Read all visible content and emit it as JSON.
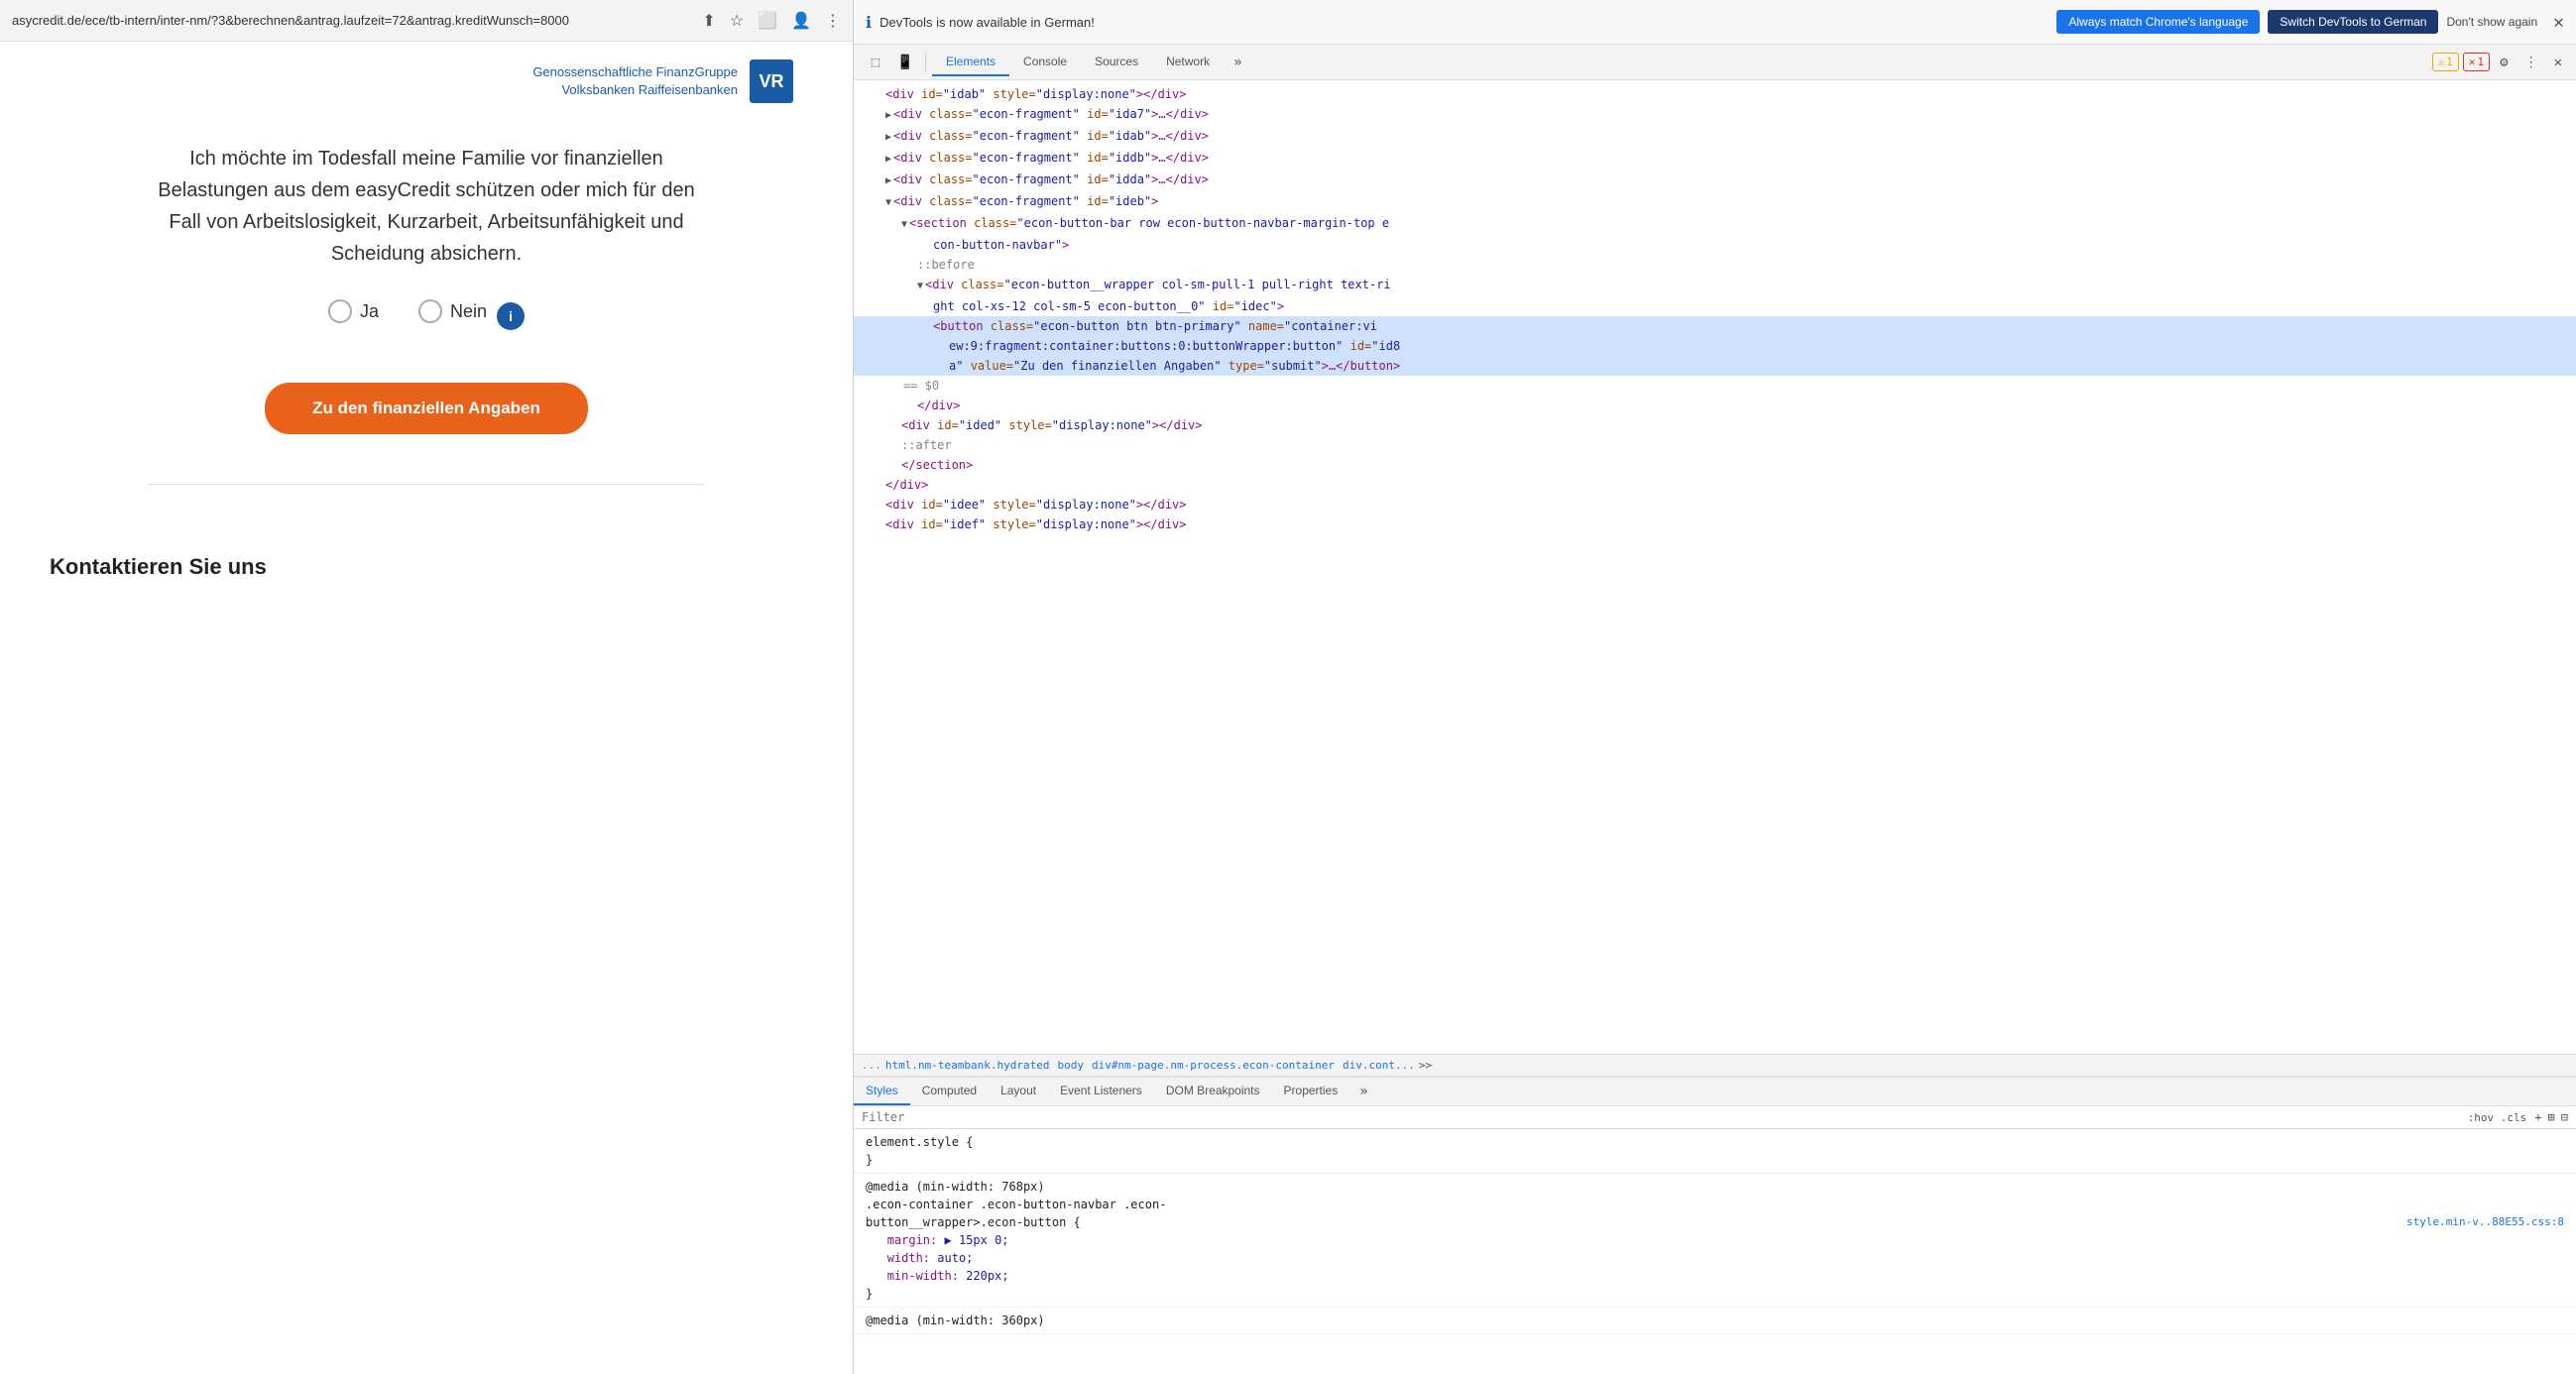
{
  "browser": {
    "url": "asycredit.de/ece/tb-intern/inter-nm/?3&berechnen&antrag.laufzeit=72&antrag.kreditWunsch=8000",
    "toolbar_icons": [
      "⬆",
      "★",
      "⬜",
      "👤",
      "⋮"
    ]
  },
  "webpage": {
    "logo_line1": "Genossenschaftliche FinanzGruppe",
    "logo_line2": "Volksbanken Raiffeisenbanken",
    "logo_letter": "VR",
    "question": "Ich möchte im Todesfall meine Familie vor finanziellen Belastungen aus dem easyCredit schützen oder mich für den Fall von Arbeitslosigkeit, Kurzarbeit, Arbeitsunfähigkeit und Scheidung absichern.",
    "radio_ja": "Ja",
    "radio_nein": "Nein",
    "submit_btn": "Zu den finanziellen Angaben",
    "contact_title": "Kontaktieren Sie uns"
  },
  "devtools": {
    "notification_text": "DevTools is now available in German!",
    "btn_always": "Always match Chrome's language",
    "btn_switch": "Switch DevTools to German",
    "dont_show": "Don't show again",
    "tabs": [
      "Elements",
      "Console",
      "Sources",
      "Network"
    ],
    "tab_active": "Elements",
    "tab_more": "»",
    "warning_count": "1",
    "error_count": "1",
    "breadcrumb": "...   html.nm-teambank.hydrated   body   div#nm-page.nm-process.econ-container   div.cont...",
    "bottom_tabs": [
      "Styles",
      "Computed",
      "Layout",
      "Event Listeners",
      "DOM Breakpoints",
      "Properties"
    ],
    "bottom_tab_active": "Styles",
    "filter_placeholder": "Filter",
    "filter_meta": ":hov  .cls",
    "html_lines": [
      {
        "indent": 1,
        "content": "<div id=\"idab\" style=\"display:none\"></div>",
        "triangle": false
      },
      {
        "indent": 1,
        "content": "▶ <div class=\"econ-fragment\" id=\"ida7\">…</div>",
        "triangle": true
      },
      {
        "indent": 1,
        "content": "▶ <div class=\"econ-fragment\" id=\"idab\">…</div>",
        "triangle": true
      },
      {
        "indent": 1,
        "content": "▶ <div class=\"econ-fragment\" id=\"iddb\">…</div>",
        "triangle": true
      },
      {
        "indent": 1,
        "content": "▶ <div class=\"econ-fragment\" id=\"idda\">…</div>",
        "triangle": true
      },
      {
        "indent": 1,
        "content": "▼ <div class=\"econ-fragment\" id=\"ideb\">",
        "triangle": true,
        "open": true
      },
      {
        "indent": 2,
        "content": "▼ <section class=\"econ-button-bar row econ-button-navbar-margin-top e con-button-navbar\">",
        "triangle": true,
        "open": true
      },
      {
        "indent": 3,
        "content": "::before",
        "comment": true
      },
      {
        "indent": 3,
        "content": "▼ <div class=\"econ-button__wrapper col-sm-pull-1 pull-right text-ri ght col-xs-12 col-sm-5  econ-button__0\" id=\"idec\">",
        "triangle": true,
        "open": true,
        "selected": false
      },
      {
        "indent": 4,
        "content": "<button class=\"econ-button btn  btn-primary\" name=\"container:vi ew:9:fragment:container:buttons:0:buttonWrapper:button\" id=\"id8 a\" value=\"Zu den finanziellen Angaben\" type=\"submit\">…</button>",
        "selected": true
      },
      {
        "indent": 3,
        "content": "</div>",
        "close": true
      },
      {
        "indent": 2,
        "content": "<div id=\"ided\" style=\"display:none\"></div>",
        "triangle": false
      },
      {
        "indent": 2,
        "content": "::after",
        "comment": true
      },
      {
        "indent": 2,
        "content": "</section>",
        "close": true
      },
      {
        "indent": 1,
        "content": "</div>",
        "close": true
      },
      {
        "indent": 1,
        "content": "<div id=\"idee\" style=\"display:none\"></div>",
        "triangle": false
      },
      {
        "indent": 1,
        "content": "<div id=\"idef\" style=\"display:none\"></div>",
        "triangle": false
      }
    ],
    "css_rules": [
      {
        "selector": "element.style {",
        "properties": [],
        "closing": "}"
      },
      {
        "selector": "@media (min-width: 768px)",
        "sub_selector": ".econ-container .econ-button-navbar .econ-button__wrapper>.econ-button {",
        "source": "style.min-v..88E55.css:8",
        "properties": [
          {
            "name": "margin:",
            "value": "▶ 15px 0;"
          },
          {
            "name": "width:",
            "value": "auto;"
          },
          {
            "name": "min-width:",
            "value": "220px;"
          }
        ],
        "closing": "}"
      },
      {
        "selector": "@media (min-width: 360px)",
        "sub_selector": "",
        "source": "",
        "properties": []
      }
    ],
    "dots1": "...",
    "dots2": "...",
    "dollar": "== $0"
  }
}
